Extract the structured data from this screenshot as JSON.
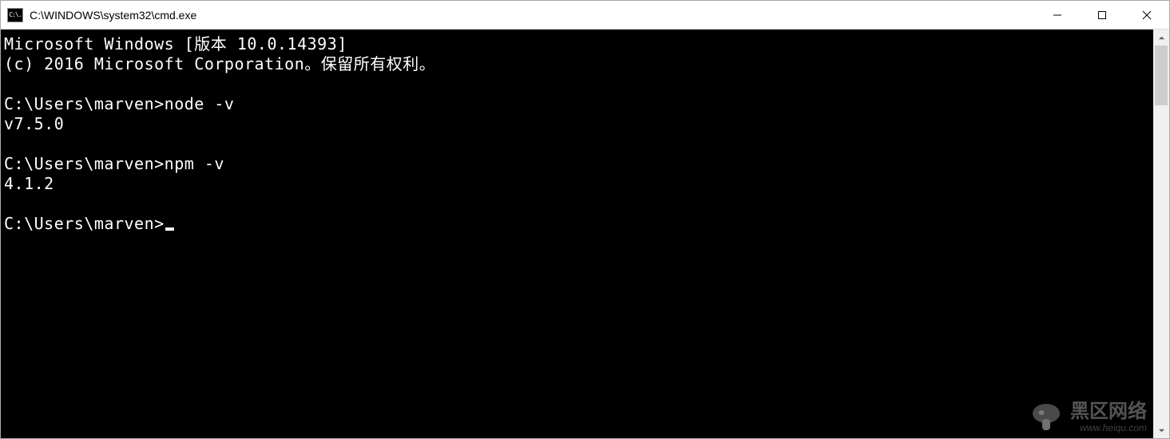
{
  "window": {
    "title": "C:\\WINDOWS\\system32\\cmd.exe",
    "app_icon_text": "C:\\."
  },
  "terminal": {
    "lines": [
      "Microsoft Windows [版本 10.0.14393]",
      "(c) 2016 Microsoft Corporation。保留所有权利。",
      "",
      "C:\\Users\\marven>node -v",
      "v7.5.0",
      "",
      "C:\\Users\\marven>npm -v",
      "4.1.2",
      "",
      "C:\\Users\\marven>"
    ]
  },
  "watermark": {
    "main": "黑区网络",
    "sub": "www.heiqu.com"
  }
}
